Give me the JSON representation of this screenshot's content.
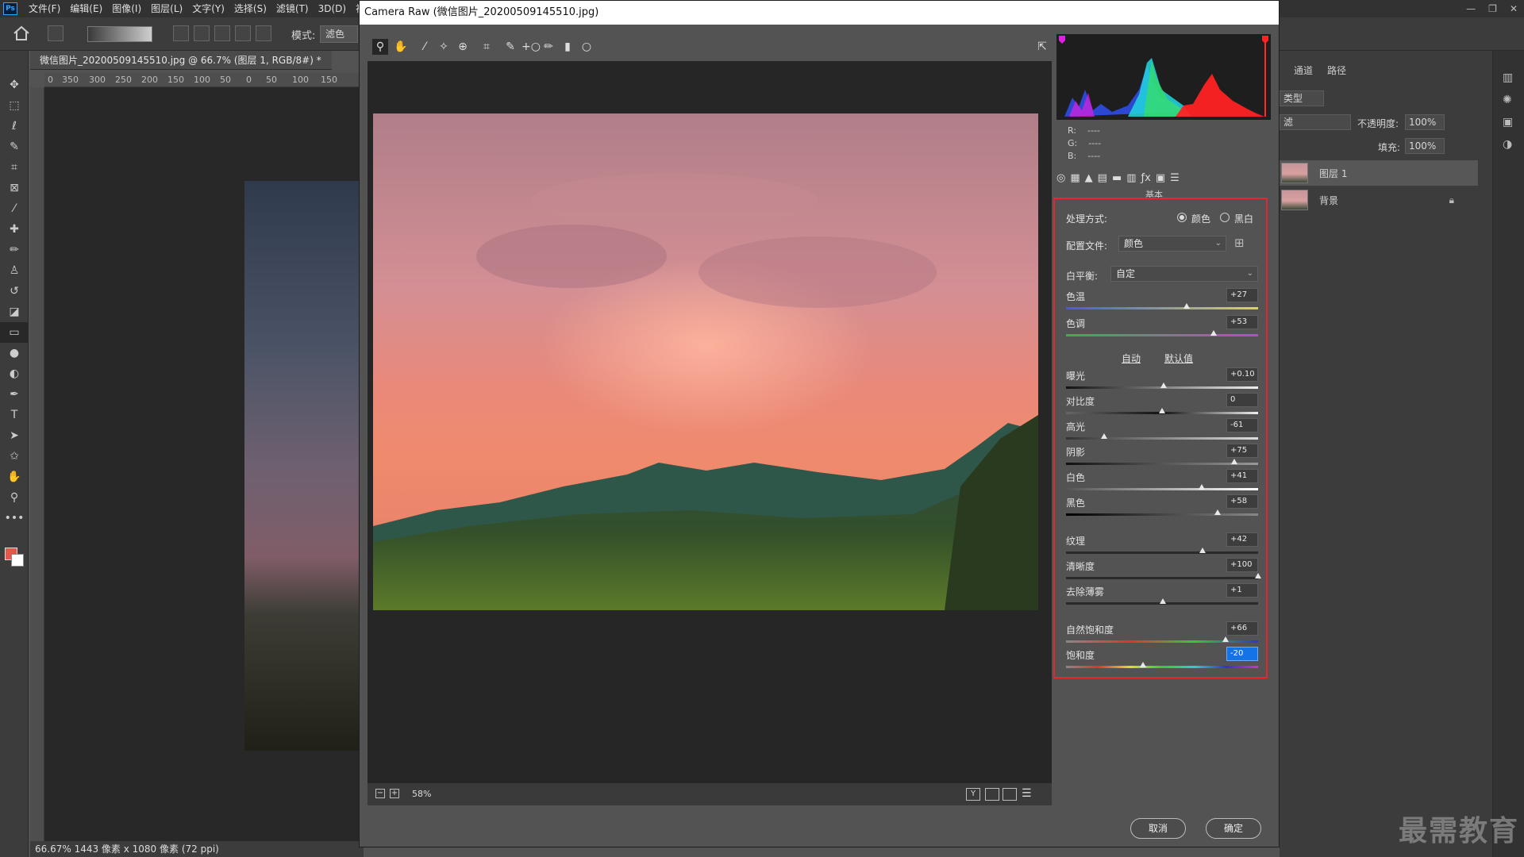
{
  "ps": {
    "logo": "Ps",
    "menu": [
      "文件(F)",
      "编辑(E)",
      "图像(I)",
      "图层(L)",
      "文字(Y)",
      "选择(S)",
      "滤镜(T)",
      "3D(D)",
      "视图("
    ],
    "window_controls": [
      "—",
      "❐",
      "✕"
    ],
    "options": {
      "mode_label": "模式:",
      "mode_value": "滤色"
    },
    "document_tab": "微信图片_20200509145510.jpg @ 66.7% (图层 1, RGB/8#) *",
    "ruler_ticks": [
      "0",
      "350",
      "300",
      "250",
      "200",
      "150",
      "100",
      "50",
      "0",
      "50",
      "100",
      "150"
    ],
    "status": "66.67%   1443 像素 x 1080 像素 (72 ppi)",
    "colors": {
      "foreground": "#e8564a",
      "background": "#ffffff"
    }
  },
  "layers_panel": {
    "tabs": [
      "通道",
      "路径"
    ],
    "kind": "类型",
    "blend": "滤",
    "opacity_label": "不透明度:",
    "opacity_value": "100%",
    "fill_label": "填充:",
    "fill_value": "100%",
    "layers": [
      {
        "name": "图层 1",
        "selected": true
      },
      {
        "name": "背景",
        "locked": true
      }
    ]
  },
  "camera_raw": {
    "title": "Camera Raw (微信图片_20200509145510.jpg)",
    "zoom": "58%",
    "cancel": "取消",
    "ok": "确定",
    "rgb": {
      "r_label": "R:",
      "g_label": "G:",
      "b_label": "B:",
      "r": "----",
      "g": "----",
      "b": "----"
    },
    "panel_name": "基本",
    "basic": {
      "treatment_label": "处理方式:",
      "treatment_color": "颜色",
      "treatment_bw": "黑白",
      "treatment_selected": "颜色",
      "profile_label": "配置文件:",
      "profile_value": "颜色",
      "wb_label": "白平衡:",
      "wb_value": "自定",
      "auto": "自动",
      "default": "默认值",
      "sliders": {
        "temp": {
          "label": "色温",
          "value": "+27",
          "fraction": 0.63
        },
        "tint": {
          "label": "色调",
          "value": "+53",
          "fraction": 0.77
        },
        "exposure": {
          "label": "曝光",
          "value": "+0.10",
          "fraction": 0.51
        },
        "contrast": {
          "label": "对比度",
          "value": "0",
          "fraction": 0.5
        },
        "highlights": {
          "label": "高光",
          "value": "-61",
          "fraction": 0.2
        },
        "shadows": {
          "label": "阴影",
          "value": "+75",
          "fraction": 0.875
        },
        "whites": {
          "label": "白色",
          "value": "+41",
          "fraction": 0.705
        },
        "blacks": {
          "label": "黑色",
          "value": "+58",
          "fraction": 0.79
        },
        "texture": {
          "label": "纹理",
          "value": "+42",
          "fraction": 0.71
        },
        "clarity": {
          "label": "清晰度",
          "value": "+100",
          "fraction": 1.0
        },
        "dehaze": {
          "label": "去除薄雾",
          "value": "+1",
          "fraction": 0.505
        },
        "vibrance": {
          "label": "自然饱和度",
          "value": "+66",
          "fraction": 0.83
        },
        "saturation": {
          "label": "饱和度",
          "value": "-20",
          "fraction": 0.4
        }
      }
    },
    "highlight_color": "#e8262e"
  },
  "watermark": "最需教育"
}
